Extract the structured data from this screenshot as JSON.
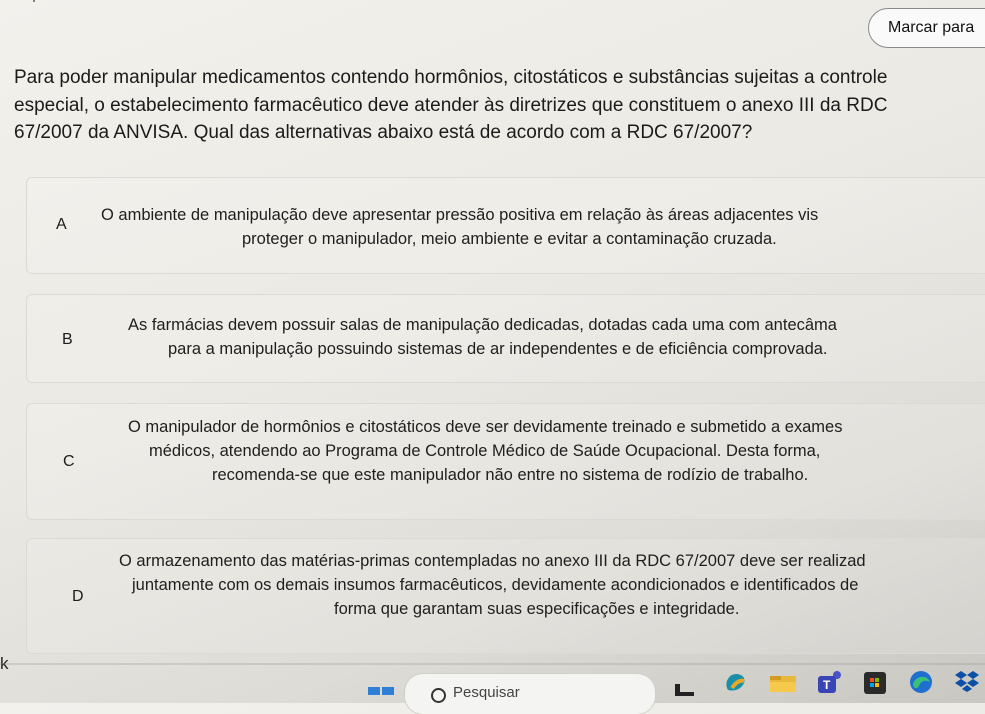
{
  "header": {
    "mark_button_label": "Marcar para"
  },
  "question": {
    "lines": [
      "Para poder manipular medicamentos contendo hormônios, citostáticos e substâncias sujeitas a controle",
      "especial, o estabelecimento farmacêutico deve atender às diretrizes que constituem o anexo III da RDC",
      "67/2007 da ANVISA. Qual das alternativas abaixo está de acordo com a RDC 67/2007?"
    ]
  },
  "options": [
    {
      "letter": "A",
      "lines": [
        "O ambiente de manipulação deve apresentar pressão positiva em relação às áreas adjacentes vis",
        "proteger o manipulador, meio ambiente e evitar a contaminação cruzada."
      ]
    },
    {
      "letter": "B",
      "lines": [
        "As farmácias devem possuir salas de manipulação dedicadas, dotadas cada uma com antecâma",
        "para a manipulação possuindo sistemas de ar independentes e de eficiência comprovada."
      ]
    },
    {
      "letter": "C",
      "lines": [
        "O manipulador de hormônios e citostáticos deve ser devidamente treinado e submetido a exames",
        "médicos, atendendo ao Programa de Controle Médico de Saúde Ocupacional. Desta forma,",
        "recomenda-se que este manipulador não entre no sistema de rodízio de trabalho."
      ]
    },
    {
      "letter": "D",
      "lines": [
        "O armazenamento das matérias-primas contempladas no anexo III da RDC 67/2007 deve ser realizad",
        "juntamente com os demais insumos farmacêuticos, devidamente acondicionados e identificados de",
        "forma que garantam suas especificações e integridade."
      ]
    }
  ],
  "taskbar": {
    "left_partial_text": "k",
    "search_placeholder": "Pesquisar",
    "icons": [
      "windows-start-icon",
      "search-icon",
      "widgets-icon",
      "copilot-icon",
      "file-explorer-icon",
      "teams-icon",
      "store-icon",
      "edge-icon",
      "dropbox-icon"
    ]
  }
}
